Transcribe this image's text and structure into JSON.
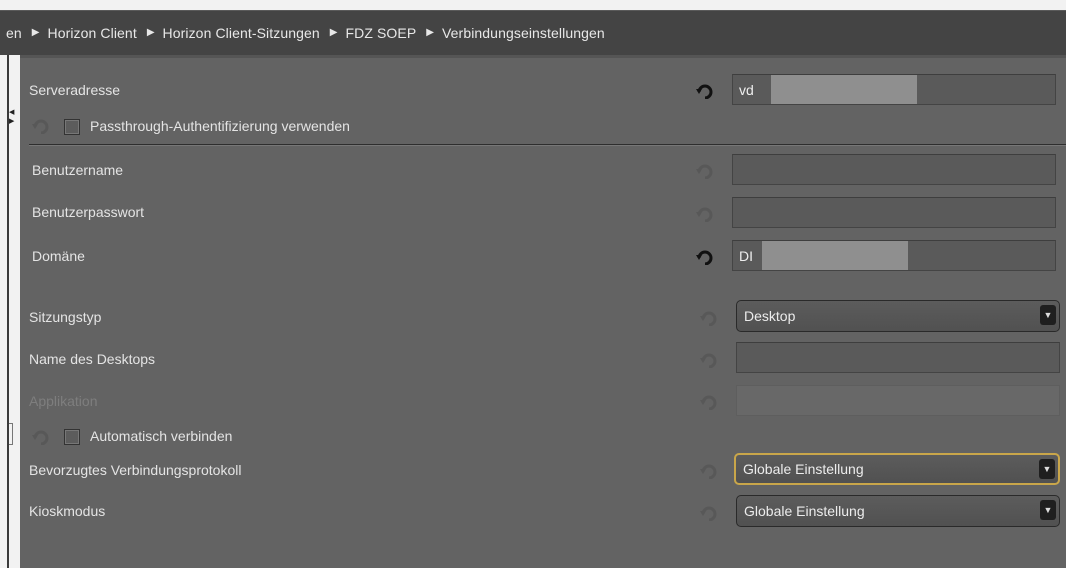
{
  "breadcrumb": {
    "items": [
      "en",
      "Horizon Client",
      "Horizon Client-Sitzungen",
      "FDZ SOEP",
      "Verbindungseinstellungen"
    ]
  },
  "fields": {
    "serveradresse": {
      "label": "Serveradresse",
      "value": "vd"
    },
    "passthrough": {
      "label": "Passthrough-Authentifizierung verwenden",
      "checked": false
    },
    "benutzername": {
      "label": "Benutzername",
      "value": ""
    },
    "benutzerpasswort": {
      "label": "Benutzerpasswort",
      "value": ""
    },
    "domaene": {
      "label": "Domäne",
      "value": "DI"
    },
    "sitzungstyp": {
      "label": "Sitzungstyp",
      "value": "Desktop"
    },
    "desktop_name": {
      "label": "Name des Desktops",
      "value": ""
    },
    "applikation": {
      "label": "Applikation",
      "value": ""
    },
    "auto_connect": {
      "label": "Automatisch verbinden",
      "checked": false
    },
    "protokoll": {
      "label": "Bevorzugtes Verbindungsprotokoll",
      "value": "Globale Einstellung"
    },
    "kioskmodus": {
      "label": "Kioskmodus",
      "value": "Globale Einstellung"
    }
  },
  "icons": {
    "reset": "reset-arrow-icon",
    "dropdown": "chevron-down-icon"
  },
  "colors": {
    "focus_accent": "#c9a64a",
    "panel_bg": "#636363",
    "header_bg": "#444444"
  }
}
